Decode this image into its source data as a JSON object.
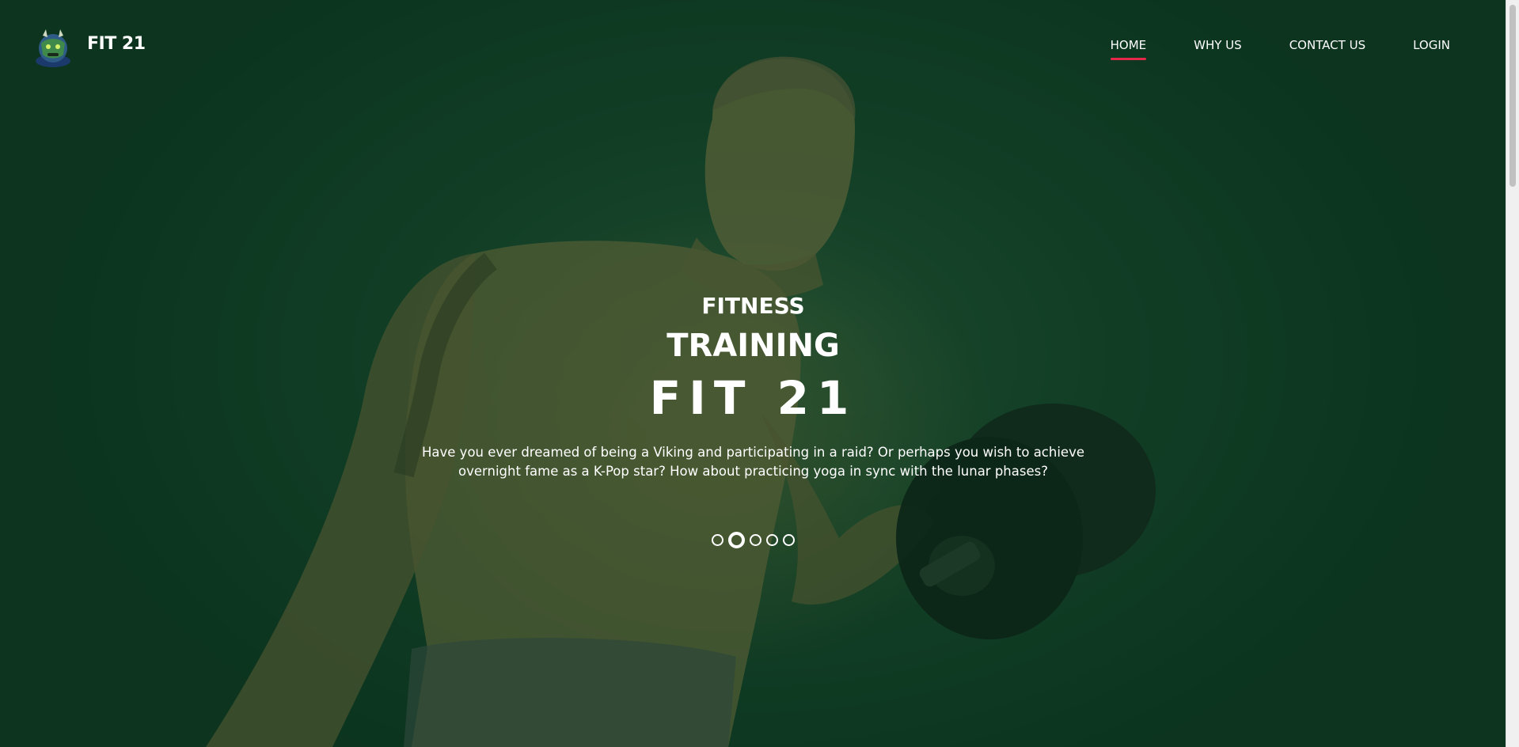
{
  "header": {
    "brand": "FIT 21",
    "nav": [
      {
        "label": "HOME",
        "active": true
      },
      {
        "label": "WHY US",
        "active": false
      },
      {
        "label": "CONTACT US",
        "active": false
      },
      {
        "label": "LOGIN",
        "active": false
      }
    ]
  },
  "hero": {
    "line1": "FITNESS",
    "line2": "TRAINING",
    "line3": "FIT 21",
    "description": "Have you ever dreamed of being a Viking and participating in a raid? Or perhaps you wish to achieve overnight fame as a K-Pop star? How about practicing yoga in sync with the lunar phases?",
    "slider": {
      "count": 5,
      "active_index": 1
    },
    "background_image": "shirtless-man-lifting-dumbbell"
  },
  "colors": {
    "overlay": "#0c3720",
    "accent": "#e3284a",
    "text": "#ffffff"
  }
}
